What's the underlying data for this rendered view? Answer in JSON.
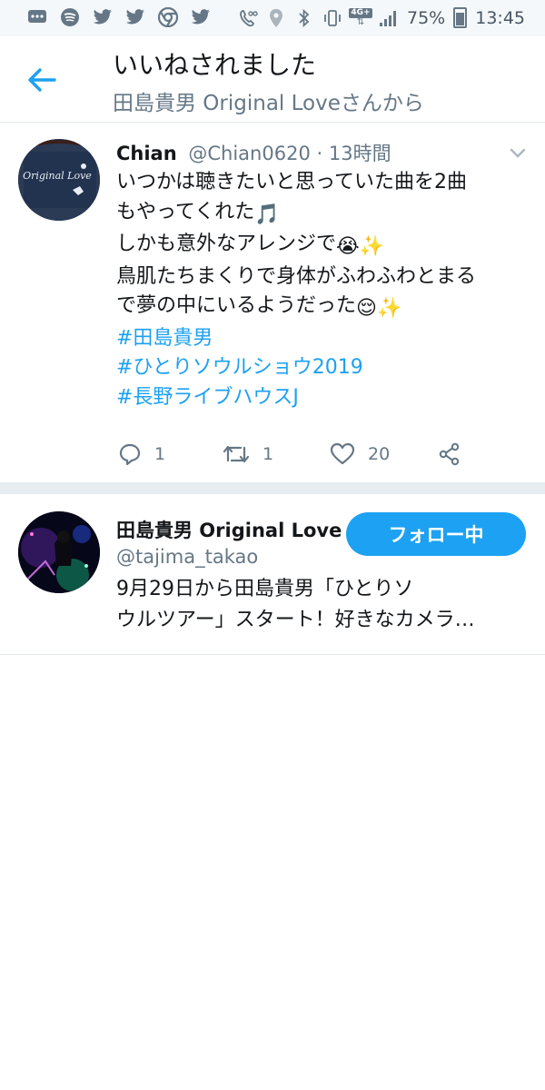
{
  "status_bar": {
    "battery": "75%",
    "time": "13:45",
    "network": "4G+",
    "left_icons": [
      "message-icon",
      "spotify-icon",
      "twitter-icon",
      "twitter-icon",
      "chrome-icon",
      "twitter-icon"
    ],
    "right_icons": [
      "voicemail-icon",
      "location-icon",
      "bluetooth-icon",
      "vibrate-icon",
      "signal-icon"
    ]
  },
  "header": {
    "title": "いいねされました",
    "subtitle": "田島貴男 Original Loveさんから"
  },
  "tweet": {
    "author_name": "Chian",
    "handle": "@Chian0620",
    "separator": " · ",
    "time": "13時間",
    "lines": [
      {
        "text": "いつかは聴きたいと思っていた曲を2曲",
        "emoji": ""
      },
      {
        "text": "もやってくれた",
        "emoji": "🎵"
      },
      {
        "text": "しかも意外なアレンジで",
        "emoji": "😭✨"
      },
      {
        "text": "鳥肌たちまくりで身体がふわふわとまる",
        "emoji": ""
      },
      {
        "text": "で夢の中にいるようだった",
        "emoji": "😌✨"
      }
    ],
    "hashtags": [
      "#田島貴男",
      "#ひとりソウルショウ2019",
      "#長野ライブハウスJ"
    ],
    "avatar_text": "Original Love",
    "reply_count": "1",
    "retweet_count": "1",
    "like_count": "20"
  },
  "user_card": {
    "name": "田島貴男 Original Love",
    "handle": "@tajima_takao",
    "follow_label": "フォロー中",
    "bio_lines": [
      "9月29日から田島貴男「ひとりソ",
      "ウルツアー」スタート！好きなカメラ…"
    ]
  },
  "colors": {
    "accent": "#1da1f2",
    "text": "#14171a",
    "muted": "#657786",
    "divider": "#e6ecf0"
  }
}
